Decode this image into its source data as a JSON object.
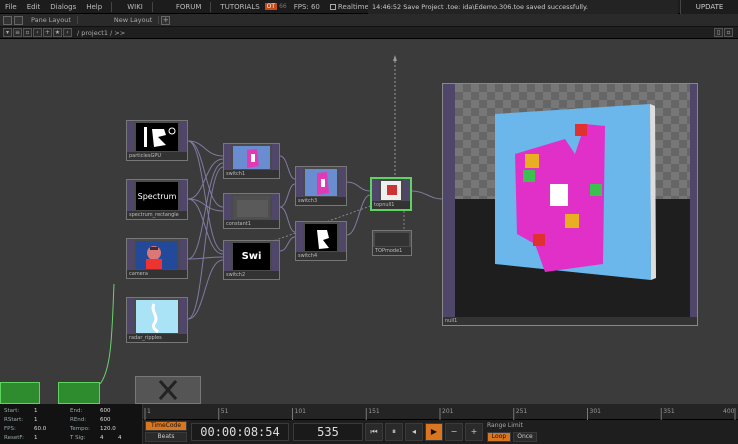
{
  "menu": {
    "items": [
      "File",
      "Edit",
      "Dialogs",
      "Help"
    ],
    "links": [
      "WIKI",
      "FORUM",
      "TUTORIALS"
    ],
    "badge_on": "OT",
    "badge_off": "66",
    "fps_label": "FPS: 60",
    "realtime_label": "Realtime",
    "status": "14:46:52 Save Project .toe: ida\\Edemo.306.toe saved successfully.",
    "update": "UPDATE"
  },
  "panebar": {
    "pane_layout": "Pane Layout",
    "new_layout": "New Layout"
  },
  "pathbar": {
    "crumb": "/ project1 / >>"
  },
  "nodes": [
    {
      "id": "particles",
      "label": "particlesGPU",
      "thumb_text": ""
    },
    {
      "id": "spectrum",
      "label": "spectrum_rectangle",
      "thumb_text": "Spectrum"
    },
    {
      "id": "camera",
      "label": "camera",
      "thumb_text": ""
    },
    {
      "id": "radar",
      "label": "radar_ripples",
      "thumb_text": ""
    },
    {
      "id": "switch1",
      "label": "switch1",
      "thumb_text": ""
    },
    {
      "id": "constant",
      "label": "constant1",
      "thumb_text": ""
    },
    {
      "id": "switch2",
      "label": "switch2",
      "thumb_text": "Swi"
    },
    {
      "id": "switch3",
      "label": "switch3",
      "thumb_text": ""
    },
    {
      "id": "switch4",
      "label": "switch4",
      "thumb_text": ""
    },
    {
      "id": "topnull",
      "label": "topnull1",
      "thumb_text": ""
    },
    {
      "id": "tlmode",
      "label": "TOPmode1",
      "thumb_text": ""
    }
  ],
  "viewer": {
    "label": "null1"
  },
  "stats": {
    "start_label": "Start:",
    "start_val": "1",
    "end_label": "End:",
    "end_val": "600",
    "rstart_label": "RStart:",
    "rstart_val": "1",
    "rend_label": "REnd:",
    "rend_val": "600",
    "fps_label": "FPS:",
    "fps_val": "60.0",
    "tempo_label": "Tempo:",
    "tempo_val": "120.0",
    "reset_label": "ResetF:",
    "reset_val": "1",
    "tsig_label": "T Sig:",
    "tsig_a": "4",
    "tsig_b": "4"
  },
  "timeline": {
    "ticks": [
      "1",
      "51",
      "101",
      "151",
      "201",
      "251",
      "301",
      "351",
      "400"
    ],
    "timecode_btn": "TimeCode",
    "beats_btn": "Beats",
    "timecode": "00:00:08:54",
    "frame": "535",
    "range_label": "Range Limit",
    "loop": "Loop",
    "once": "Once"
  },
  "colors": {
    "accent": "#d8771f",
    "node_strip": "#50466a",
    "selected": "#5fd35f"
  }
}
